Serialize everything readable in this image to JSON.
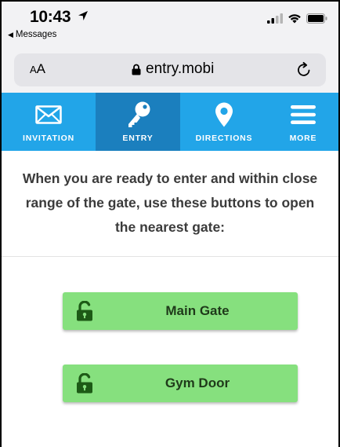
{
  "status_bar": {
    "time": "10:43",
    "back_label": "Messages"
  },
  "browser": {
    "text_size_label_small": "A",
    "text_size_label_large": "A",
    "url": "entry.mobi"
  },
  "nav": {
    "items": [
      {
        "label": "INVITATION",
        "icon": "envelope-icon"
      },
      {
        "label": "ENTRY",
        "icon": "key-icon",
        "active": true
      },
      {
        "label": "DIRECTIONS",
        "icon": "map-pin-icon"
      },
      {
        "label": "MORE",
        "icon": "menu-icon"
      }
    ]
  },
  "main": {
    "instructions": "When you are ready to enter and within close range of the gate, use these buttons to open the nearest gate:",
    "gates": [
      {
        "label": "Main Gate",
        "icon": "unlock-icon"
      },
      {
        "label": "Gym Door",
        "icon": "unlock-icon"
      }
    ]
  },
  "colors": {
    "nav_background": "#22a5e8",
    "nav_active": "#1b7fbe",
    "gate_button": "#86e07e",
    "lock_icon": "#1d5a16",
    "instruction_text": "#3b3b3b"
  }
}
